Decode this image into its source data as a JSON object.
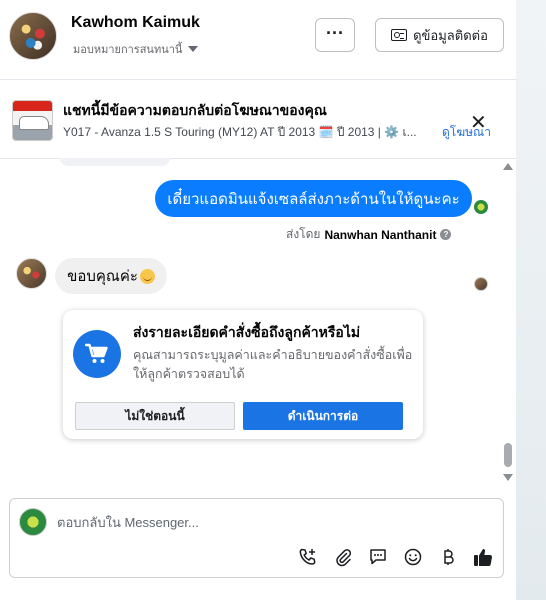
{
  "header": {
    "contact_name": "Kawhom Kaimuk",
    "assign_label": "มอบหมายการสนทนานี้",
    "more_label": "···",
    "contact_info_label": "ดูข้อมูลติดต่อ"
  },
  "ad_banner": {
    "title": "แชทนี้มีข้อความตอบกลับต่อโฆษณาของคุณ",
    "subtitle": "Y017 - Avanza 1.5 S Touring (MY12) AT ปี 2013 🗓️ ปี 2013 | ⚙️ เ...",
    "view_ad_label": "ดูโฆษณา",
    "close_label": "✕"
  },
  "messages": {
    "outgoing_text": "เดี๋ยวแอดมินแจ้งเซลล์ส่งภาะด้านในให้ดูนะคะ",
    "sent_by_prefix": "ส่งโดย",
    "sent_by_name": "Nanwhan Nanthanit",
    "incoming_text": "ขอบคุณค่ะ"
  },
  "order_card": {
    "title": "ส่งรายละเอียดคำสั่งซื้อถึงลูกค้าหรือไม่",
    "description": "คุณสามารถระบุมูลค่าและคำอธิบายของคำสั่งซื้อเพื่อให้ลูกค้าตรวจสอบได้",
    "not_now_label": "ไม่ใช่ตอนนี้",
    "continue_label": "ดำเนินการต่อ"
  },
  "composer": {
    "placeholder": "ตอบกลับใน Messenger..."
  },
  "colors": {
    "accent": "#0a7cff",
    "button_blue": "#1b74e4",
    "link": "#216fdb"
  }
}
